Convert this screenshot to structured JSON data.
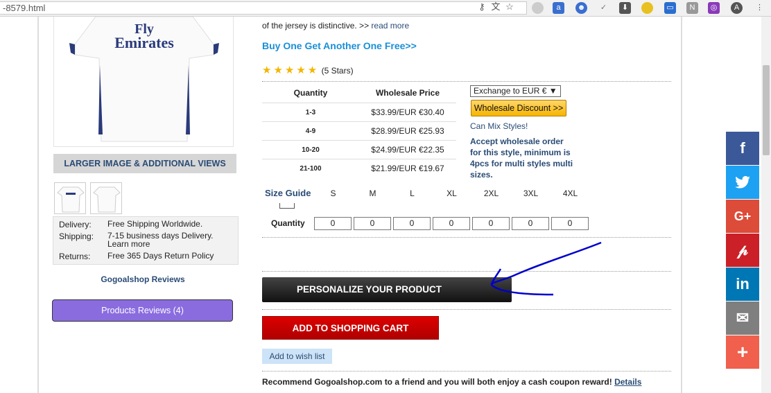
{
  "browser": {
    "url": "-8579.html",
    "icons": [
      "key-icon",
      "translate-icon",
      "star-icon"
    ]
  },
  "product": {
    "desc_tail": "of the jersey is distinctive. >>",
    "read_more": "read more",
    "promo": "Buy One Get Another One Free>>",
    "stars": "★★★★★",
    "rating_text": "(5 Stars)",
    "jersey_text_1": "Fly",
    "jersey_text_2": "Emirates"
  },
  "left": {
    "larger_images": "LARGER IMAGE & ADDITIONAL VIEWS",
    "shipping": [
      {
        "k": "Delivery:",
        "v": "Free Shipping Worldwide."
      },
      {
        "k": "Shipping:",
        "v": "7-15 business days Delivery.",
        "v2": "Learn more"
      },
      {
        "k": "Returns:",
        "v": "Free 365 Days Return Policy"
      }
    ],
    "reviews_link": "Gogoalshop Reviews",
    "products_reviews": "Products Reviews (4)"
  },
  "pricing": {
    "headers": [
      "Quantity",
      "Wholesale Price"
    ],
    "rows": [
      {
        "qty": "1-3",
        "price": "$33.99/EUR €30.40"
      },
      {
        "qty": "4-9",
        "price": "$28.99/EUR €25.93"
      },
      {
        "qty": "10-20",
        "price": "$24.99/EUR €22.35"
      },
      {
        "qty": "21-100",
        "price": "$21.99/EUR €19.67"
      }
    ],
    "exchange": "Exchange to EUR €",
    "discount_btn": "Wholesale Discount >>",
    "mix": "Can Mix Styles!",
    "accept": "Accept wholesale order for this style, minimum is 4pcs for multi styles multi sizes."
  },
  "sizes": {
    "guide": "Size Guide",
    "labels": [
      "S",
      "M",
      "L",
      "XL",
      "2XL",
      "3XL",
      "4XL"
    ],
    "quantity_label": "Quantity",
    "values": [
      "0",
      "0",
      "0",
      "0",
      "0",
      "0",
      "0"
    ]
  },
  "actions": {
    "personalize": "PERSONALIZE YOUR PRODUCT",
    "add_to_cart": "ADD TO SHOPPING CART",
    "wishlist": "Add to wish list",
    "recommend": "Recommend Gogoalshop.com to a friend and you will both enjoy a cash coupon reward!",
    "details": "Details"
  },
  "share": {
    "buttons": [
      {
        "name": "facebook",
        "glyph": "f",
        "color": "#3b5998"
      },
      {
        "name": "twitter",
        "glyph": "🐦",
        "color": "#1da1f2"
      },
      {
        "name": "google-plus",
        "glyph": "G+",
        "color": "#dd4b39"
      },
      {
        "name": "pinterest",
        "glyph": "P",
        "color": "#cb2027"
      },
      {
        "name": "linkedin",
        "glyph": "in",
        "color": "#0077b5"
      },
      {
        "name": "email",
        "glyph": "✉",
        "color": "#7f7f7f"
      },
      {
        "name": "more",
        "glyph": "+",
        "color": "#f0604c"
      }
    ]
  },
  "colors": {
    "link": "#2a4b75",
    "promo": "#1a8fd6",
    "annotation": "#0000cc"
  }
}
